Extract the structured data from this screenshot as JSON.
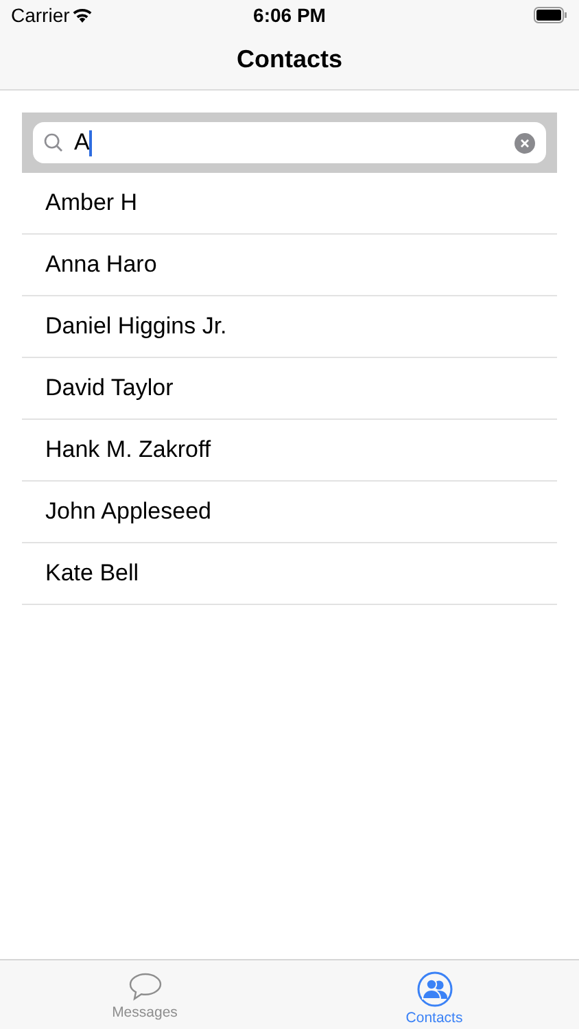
{
  "status_bar": {
    "carrier": "Carrier",
    "time": "6:06 PM"
  },
  "nav_bar": {
    "title": "Contacts"
  },
  "search": {
    "value": "A",
    "focused": true
  },
  "contacts": [
    {
      "name": "Amber H"
    },
    {
      "name": "Anna Haro"
    },
    {
      "name": "Daniel Higgins Jr."
    },
    {
      "name": "David Taylor"
    },
    {
      "name": "Hank M. Zakroff"
    },
    {
      "name": "John Appleseed"
    },
    {
      "name": "Kate Bell"
    }
  ],
  "tab_bar": [
    {
      "label": "Messages",
      "kind": "messages",
      "selected": false
    },
    {
      "label": "Contacts",
      "kind": "contacts",
      "selected": true
    }
  ]
}
